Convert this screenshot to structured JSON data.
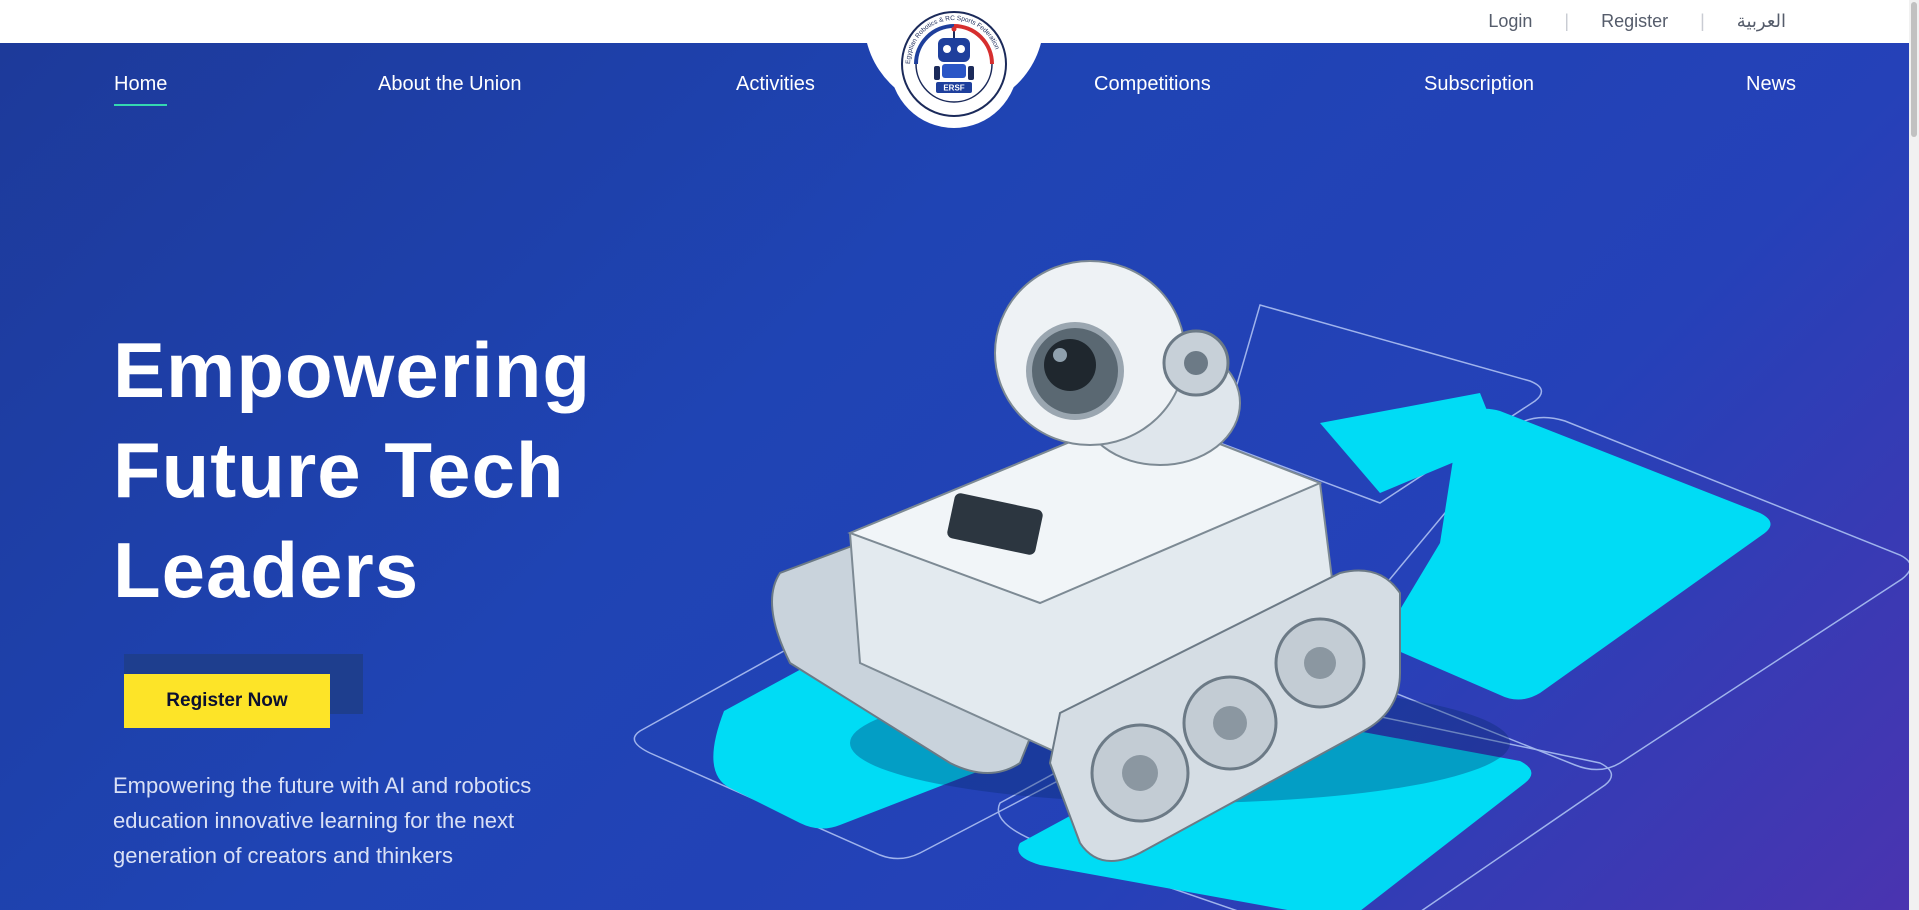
{
  "top_links": {
    "login": "Login",
    "separator": "|",
    "register": "Register",
    "language": "العربية"
  },
  "nav": {
    "items": [
      {
        "label": "Home",
        "active": true
      },
      {
        "label": "About the Union",
        "active": false
      },
      {
        "label": "Activities",
        "active": false
      },
      {
        "label": "Competitions",
        "active": false
      },
      {
        "label": "Subscription",
        "active": false
      },
      {
        "label": "News",
        "active": false
      }
    ]
  },
  "logo": {
    "text": "ERSF",
    "ring_text": "Egyptian Robotics & RC Sports Federation"
  },
  "hero": {
    "headline_line1": "Empowering",
    "headline_line2": "Future Tech",
    "headline_line3": "Leaders",
    "cta_label": "Register Now",
    "description": "Empowering the future with AI and robotics education innovative learning for the next generation of creators and thinkers"
  },
  "colors": {
    "accent": "#fde428",
    "nav_underline": "#35d8b0",
    "tile": "#00dcf5",
    "background": "#1f44b4"
  }
}
